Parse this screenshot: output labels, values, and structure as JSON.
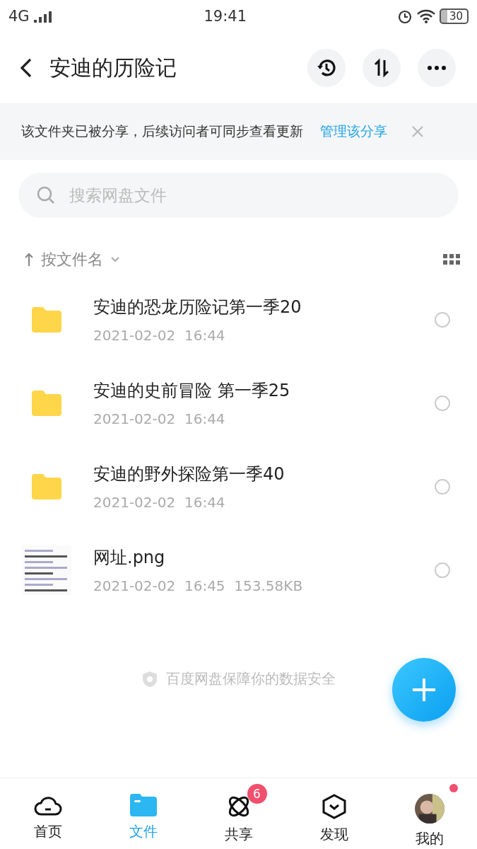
{
  "status_bar": {
    "network": "4G",
    "time": "19:41",
    "battery": "30"
  },
  "header": {
    "title": "安迪的历险记"
  },
  "share_banner": {
    "text": "该文件夹已被分享，后续访问者可同步查看更新",
    "link": "管理该分享"
  },
  "search": {
    "placeholder": "搜索网盘文件"
  },
  "sort": {
    "label": "按文件名"
  },
  "files": [
    {
      "kind": "folder",
      "name": "安迪的恐龙历险记第一季20",
      "date": "2021-02-02  16:44",
      "checked": false
    },
    {
      "kind": "folder",
      "name": "安迪的史前冒险 第一季25",
      "date": "2021-02-02  16:44",
      "checked": false
    },
    {
      "kind": "folder",
      "name": "安迪的野外探险第一季40",
      "date": "2021-02-02  16:44",
      "checked": false
    },
    {
      "name": "网址.png",
      "date": "2021-02-02  16:45",
      "size": "153.58KB",
      "checked": false
    }
  ],
  "footer_note": "百度网盘保障你的数据安全",
  "tabs": [
    {
      "kind": "cloud",
      "label": "首页",
      "selected": false
    },
    {
      "kind": "folder",
      "label": "文件",
      "selected": true
    },
    {
      "kind": "atom",
      "label": "共享",
      "selected": false,
      "badge": "6"
    },
    {
      "kind": "hex",
      "label": "发现",
      "selected": false
    },
    {
      "kind": "avatar",
      "label": "我的",
      "selected": false,
      "dot": true
    }
  ]
}
